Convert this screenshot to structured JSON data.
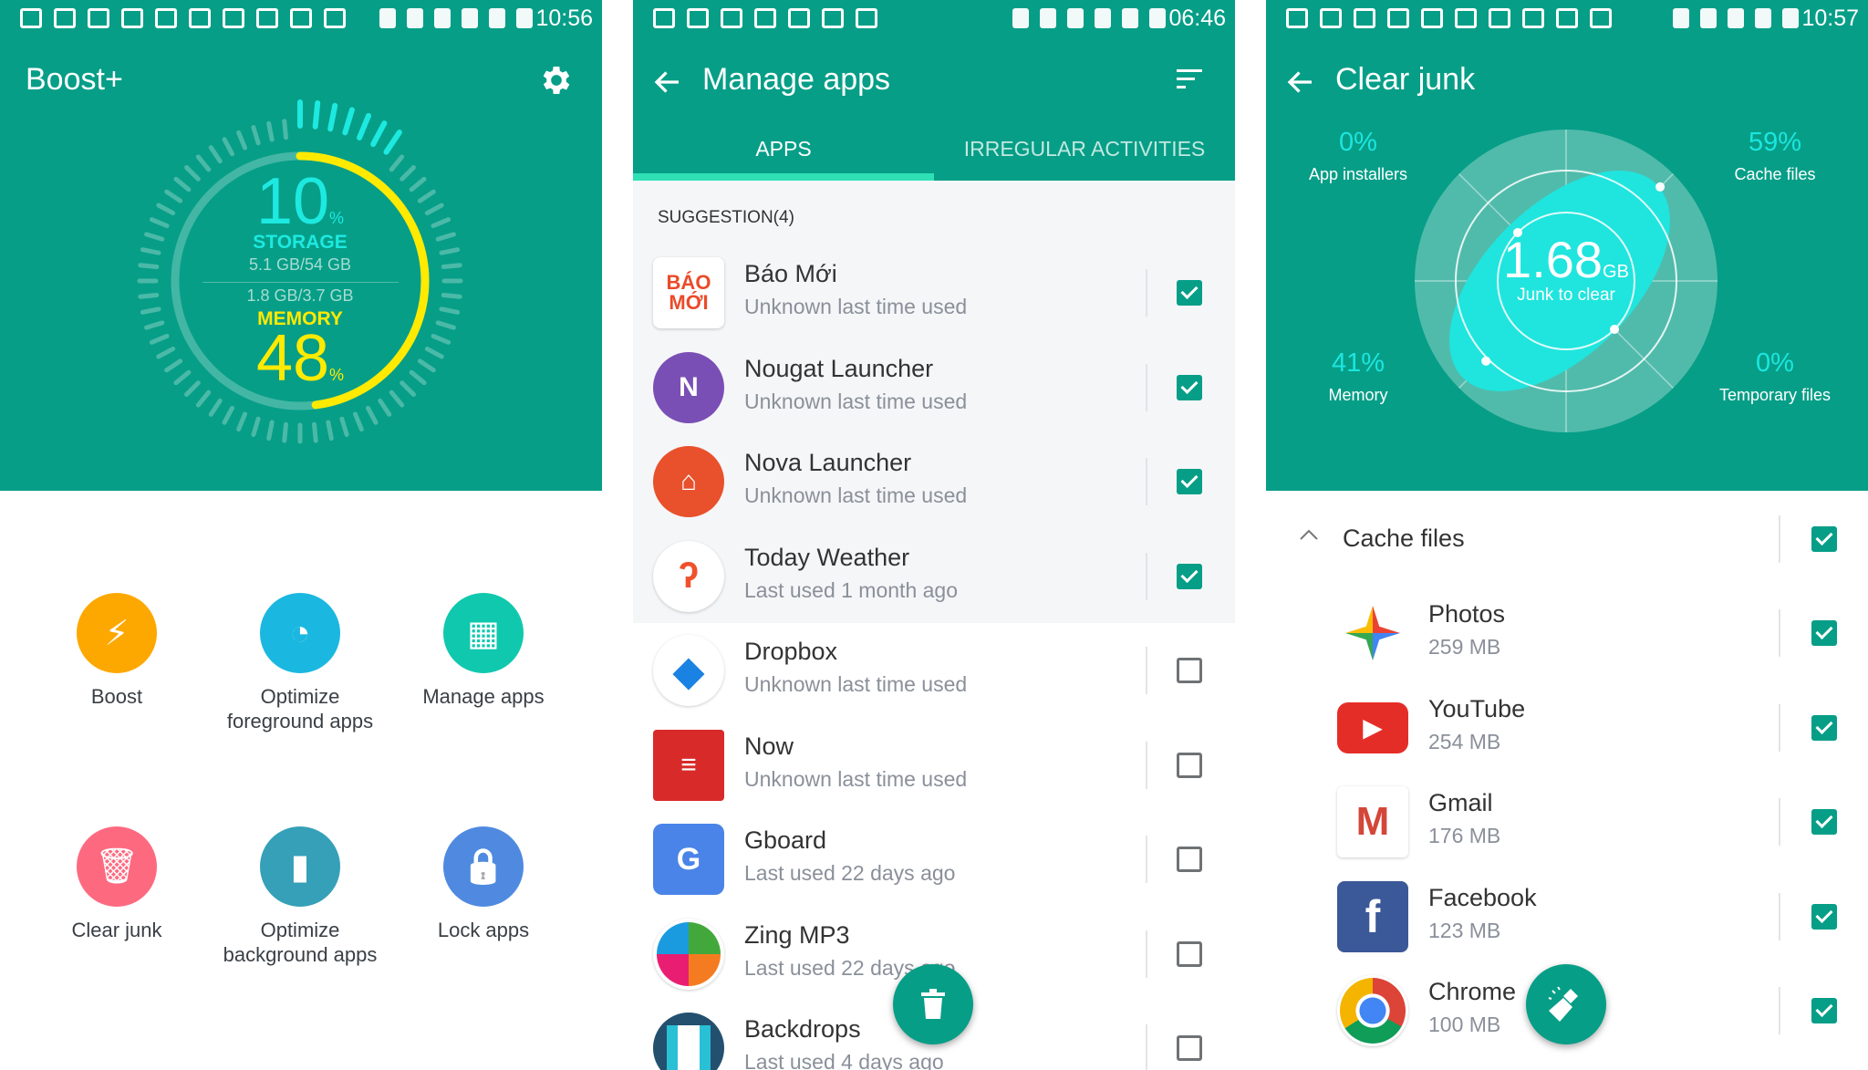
{
  "colors": {
    "teal": "#069e87",
    "cyan": "#1de9e0",
    "yellow": "#ffea00",
    "checkbox": "#069e87"
  },
  "boost": {
    "status_time": "10:56",
    "title": "Boost+",
    "settings_icon": "gear-icon",
    "storage": {
      "percent": "10",
      "unit": "%",
      "label": "STORAGE",
      "usage": "5.1 GB/54 GB",
      "value_percent": 10
    },
    "memory": {
      "percent": "48",
      "unit": "%",
      "label": "MEMORY",
      "usage": "1.8 GB/3.7 GB",
      "value_percent": 48
    },
    "tiles": [
      {
        "label": "Boost",
        "icon": "lightning-icon",
        "color": "#fda800"
      },
      {
        "label": "Optimize\nforeground apps",
        "icon": "speedometer-icon",
        "color": "#1ab8e0"
      },
      {
        "label": "Manage apps",
        "icon": "grid-icon",
        "color": "#10c8ae"
      },
      {
        "label": "Clear junk",
        "icon": "trash-icon",
        "color": "#fd6a80"
      },
      {
        "label": "Optimize\nbackground apps",
        "icon": "battery-leaf-icon",
        "color": "#35a0b8"
      },
      {
        "label": "Lock apps",
        "icon": "lock-icon",
        "color": "#4f8ae0"
      }
    ]
  },
  "manage": {
    "status_time": "06:46",
    "title": "Manage apps",
    "tabs": [
      {
        "label": "APPS",
        "active": true
      },
      {
        "label": "IRREGULAR ACTIVITIES",
        "active": false
      }
    ],
    "section": "SUGGESTION(4)",
    "apps": [
      {
        "name": "Báo Mới",
        "sub": "Unknown last time used",
        "checked": true,
        "icon": "bao-moi-logo",
        "logo_text": "BÁO MỚI",
        "color": "#ffffff",
        "suggested": true
      },
      {
        "name": "Nougat Launcher",
        "sub": "Unknown last time used",
        "checked": true,
        "icon": "nougat-launcher-icon",
        "color": "#7a4fb5",
        "suggested": true
      },
      {
        "name": "Nova Launcher",
        "sub": "Unknown last time used",
        "checked": true,
        "icon": "nova-launcher-icon",
        "color": "#e8512c",
        "suggested": true
      },
      {
        "name": "Today Weather",
        "sub": "Last used 1 month ago",
        "checked": true,
        "icon": "today-weather-icon",
        "color": "#ffffff",
        "suggested": true
      },
      {
        "name": "Dropbox",
        "sub": "Unknown last time used",
        "checked": false,
        "icon": "dropbox-icon",
        "color": "#ffffff",
        "suggested": false
      },
      {
        "name": "Now",
        "sub": "Unknown last time used",
        "checked": false,
        "icon": "now-icon",
        "color": "#d92a2a",
        "suggested": false
      },
      {
        "name": "Gboard",
        "sub": "Last used 22 days ago",
        "checked": false,
        "icon": "gboard-icon",
        "color": "#4a84e8",
        "suggested": false
      },
      {
        "name": "Zing MP3",
        "sub": "Last used 22 days ago",
        "checked": false,
        "icon": "zing-mp3-icon",
        "color": "#ffffff",
        "suggested": false
      },
      {
        "name": "Backdrops",
        "sub": "Last used 4 days ago",
        "checked": false,
        "icon": "backdrops-icon",
        "color": "#23506e",
        "suggested": false
      }
    ]
  },
  "junk": {
    "status_time": "10:57",
    "title": "Clear junk",
    "total": "1.68",
    "total_unit": "GB",
    "total_label": "Junk to clear",
    "categories": [
      {
        "pct": "0%",
        "name": "App installers",
        "value": 0
      },
      {
        "pct": "59%",
        "name": "Cache files",
        "value": 59
      },
      {
        "pct": "41%",
        "name": "Memory",
        "value": 41
      },
      {
        "pct": "0%",
        "name": "Temporary files",
        "value": 0
      }
    ],
    "section": {
      "label": "Cache files",
      "checked": true,
      "expanded": true
    },
    "items": [
      {
        "name": "Photos",
        "size": "259 MB",
        "checked": true,
        "icon": "google-photos-icon"
      },
      {
        "name": "YouTube",
        "size": "254 MB",
        "checked": true,
        "icon": "youtube-icon"
      },
      {
        "name": "Gmail",
        "size": "176 MB",
        "checked": true,
        "icon": "gmail-icon"
      },
      {
        "name": "Facebook",
        "size": "123 MB",
        "checked": true,
        "icon": "facebook-icon"
      },
      {
        "name": "Chrome",
        "size": "100 MB",
        "checked": true,
        "icon": "chrome-icon"
      }
    ]
  }
}
